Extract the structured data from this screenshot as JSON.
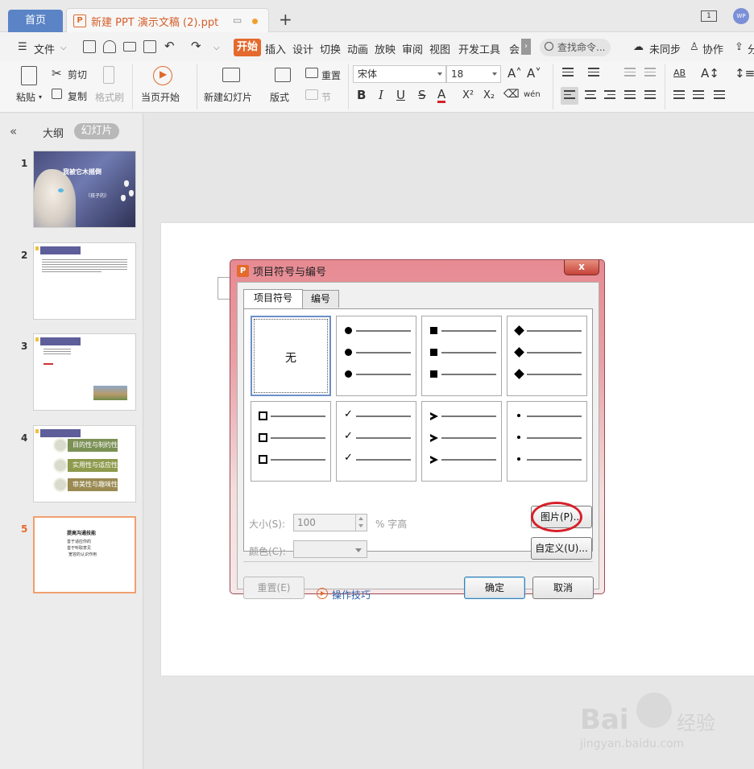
{
  "titlebar": {
    "home_tab": "首页",
    "doc_title": "新建 PPT 演示文稿 (2).ppt",
    "ppt_icon_letter": "P",
    "add_tab": "+",
    "window_count": "1",
    "avatar_text": "WP"
  },
  "menubar": {
    "file": "文件",
    "items": [
      "开始",
      "插入",
      "设计",
      "切换",
      "动画",
      "放映",
      "审阅",
      "视图",
      "开发工具",
      "会"
    ],
    "search_placeholder": "查找命令...",
    "sync": "未同步",
    "collab": "协作",
    "share": "分"
  },
  "ribbon": {
    "paste": "粘贴",
    "cut": "剪切",
    "copy": "复制",
    "format_painter": "格式刷",
    "from_current": "当页开始",
    "new_slide": "新建幻灯片",
    "layout": "版式",
    "reset": "重置",
    "section": "节",
    "font_name": "宋体",
    "font_size": "18",
    "bold": "B",
    "italic": "I",
    "underline": "U",
    "strike": "S",
    "font_color": "A",
    "superscript": "X²",
    "subscript": "X₂",
    "phonetic": "wén"
  },
  "leftpanel": {
    "collapse": "«",
    "tab_outline": "大纲",
    "tab_slides": "幻灯片",
    "slides": [
      {
        "num": "1",
        "title": "我被它木摇倒",
        "sub": "（孩子的）"
      },
      {
        "num": "2"
      },
      {
        "num": "3"
      },
      {
        "num": "4",
        "pills": [
          "目的性与制约性",
          "实用性与适应性",
          "审美性与趣味性"
        ]
      },
      {
        "num": "5",
        "heading": "提高沟通技能",
        "lines": [
          "善于适应你的",
          "善于听取意见",
          "宽容的认识作用"
        ]
      }
    ]
  },
  "dialog": {
    "title": "项目符号与编号",
    "icon_letter": "P",
    "close": "x",
    "tab_bullets": "项目符号",
    "tab_numbering": "编号",
    "none_label": "无",
    "size_label": "大小(S):",
    "size_value": "100",
    "size_unit": "% 字高",
    "color_label": "颜色(C):",
    "picture_button": "图片(P)...",
    "custom_button": "自定义(U)...",
    "reset_button": "重置(E)",
    "tips_link": "操作技巧",
    "ok_button": "确定",
    "cancel_button": "取消"
  },
  "watermark": {
    "logo": "Bai",
    "logo_cn": "经验",
    "url": "jingyan.baidu.com"
  },
  "colors": {
    "accent": "#e46a2d",
    "home_tab": "#5a84c6",
    "dialog_frame": "#e78a92",
    "annotation": "#d6202a"
  }
}
